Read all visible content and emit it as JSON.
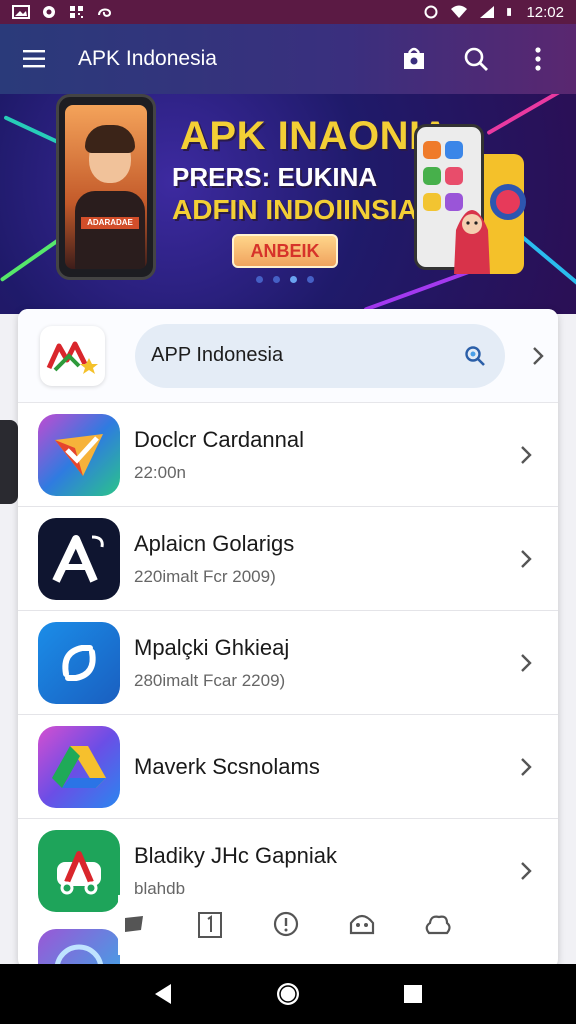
{
  "status_bar": {
    "time": "12:02"
  },
  "app_bar": {
    "title": "APK Indonesia"
  },
  "banner": {
    "line1": "APK INAONIA",
    "line2": "PRERS: EUKINA",
    "line3": "ADFIN INDOIINSIA",
    "button_label": "ANBEIK",
    "shirt_text": "ADARADAE",
    "active_dot_index": 2,
    "dot_count": 4
  },
  "search": {
    "value": "APP Indonesia",
    "placeholder": ""
  },
  "apps": [
    {
      "name": "Doclcr Cardannal",
      "sub": "22:00n",
      "icon": "envelope-check-icon"
    },
    {
      "name": "Aplaicn Golarigs",
      "sub": "220imalt Fcr 2009)",
      "icon": "letter-a-icon"
    },
    {
      "name": "Mpalçki Ghkieaj",
      "sub": "280imalt Fcar 2209)",
      "icon": "sync-arrows-icon"
    },
    {
      "name": "Maverk Scsnolams",
      "sub": "",
      "icon": "drive-triangle-icon"
    },
    {
      "name": "Bladiky JHc Gapniak",
      "sub": "blahdb",
      "icon": "car-a-icon"
    }
  ],
  "toolbar": {
    "items": [
      "note-icon",
      "number-one-icon",
      "alert-circle-icon",
      "bot-face-icon",
      "cloud-puzzle-icon"
    ]
  },
  "colors": {
    "appbar_start": "#2a3a7a",
    "appbar_end": "#5a2770",
    "status_bar": "#5b1a44",
    "banner_yellow": "#f3cf35",
    "search_bg": "#e4ecf6"
  }
}
